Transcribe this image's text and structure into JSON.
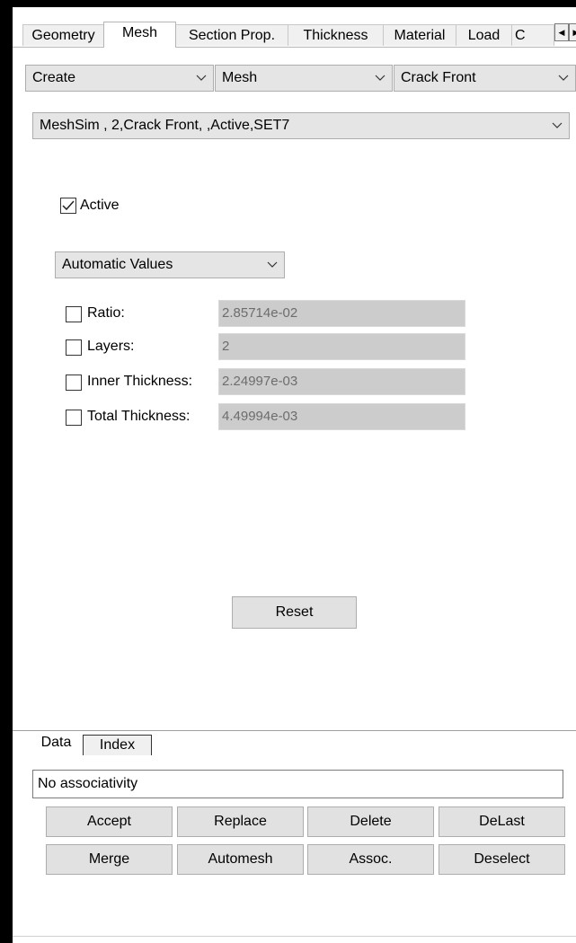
{
  "tabs": {
    "items": [
      "Geometry",
      "Mesh",
      "Section Prop.",
      "Thickness",
      "Material",
      "Load",
      "C"
    ],
    "active": "Mesh"
  },
  "selectors": {
    "action": "Create",
    "entity": "Mesh",
    "type": "Crack Front"
  },
  "mesh_select": "MeshSim , 2,Crack Front, ,Active,SET7",
  "active_checkbox": {
    "label": "Active",
    "checked": true
  },
  "mode_select": "Automatic Values",
  "params": [
    {
      "label": "Ratio:",
      "value": "2.85714e-02",
      "checked": false
    },
    {
      "label": "Layers:",
      "value": "2",
      "checked": false
    },
    {
      "label": "Inner Thickness:",
      "value": "2.24997e-03",
      "checked": false
    },
    {
      "label": "Total Thickness:",
      "value": "4.49994e-03",
      "checked": false
    }
  ],
  "reset_label": "Reset",
  "bottom_tabs": {
    "items": [
      "Data",
      "Index"
    ],
    "active": "Data"
  },
  "associativity": "No associativity",
  "buttons_row1": [
    "Accept",
    "Replace",
    "Delete",
    "DeLast"
  ],
  "buttons_row2": [
    "Merge",
    "Automesh",
    "Assoc.",
    "Deselect"
  ],
  "icons": {
    "dropdown": "chevron-down-icon",
    "scroll_left": "triangle-left-icon",
    "scroll_right": "triangle-right-icon",
    "check": "checkmark-icon"
  },
  "colors": {
    "field_disabled_bg": "#cccccc",
    "field_disabled_text": "#6d6d6d",
    "button_bg": "#e1e1e1"
  }
}
